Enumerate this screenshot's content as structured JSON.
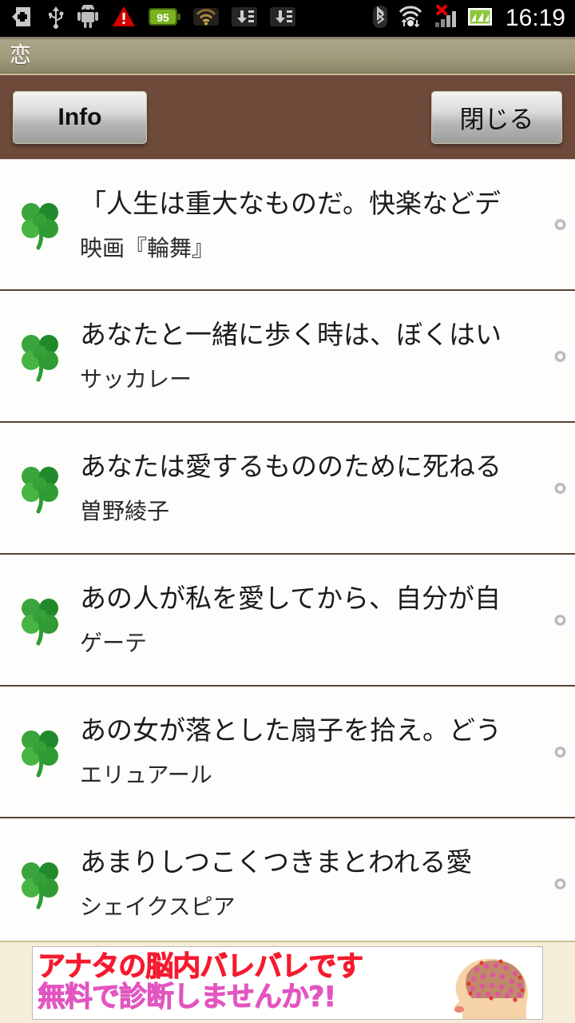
{
  "statusbar": {
    "time": "16:19",
    "battery_level": "95",
    "icons": [
      "shield-plus-icon",
      "usb-icon",
      "android-robot-icon",
      "warning-triangle-icon",
      "battery-95-icon",
      "wifi-brown-icon",
      "download-list-icon-1",
      "download-list-icon-2",
      "bluetooth-icon",
      "wifi-transfer-icon",
      "signal-no-service-icon",
      "signal-graph-icon"
    ]
  },
  "titlebar": {
    "title": "恋"
  },
  "toolbar": {
    "info_label": "Info",
    "close_label": "閉じる"
  },
  "list": {
    "items": [
      {
        "quote": "「人生は重大なものだ。快楽などデ",
        "author": "映画『輪舞』",
        "icon": "clover-icon"
      },
      {
        "quote": "あなたと一緒に歩く時は、ぼくはい",
        "author": "サッカレー",
        "icon": "clover-icon"
      },
      {
        "quote": "あなたは愛するもののために死ねる",
        "author": "曽野綾子",
        "icon": "clover-icon"
      },
      {
        "quote": "あの人が私を愛してから、自分が自",
        "author": "ゲーテ",
        "icon": "clover-icon"
      },
      {
        "quote": "あの女が落とした扇子を拾え。どう",
        "author": "エリュアール",
        "icon": "clover-icon"
      },
      {
        "quote": "あまりしつこくつきまとわれる愛",
        "author": "シェイクスピア",
        "icon": "clover-icon"
      }
    ]
  },
  "ad": {
    "line1": "アナタの脳内バレバレです",
    "line2": "無料で診断しませんか?!",
    "image": "head-brain-icon"
  },
  "colors": {
    "titlebar_khaki": "#a29b7d",
    "buttonbar_brown": "#6d4a3a",
    "divider_brown": "#5d4036",
    "clover_green": "#2e9b33",
    "ad_red": "#f51a2e",
    "ad_pink": "#e255c0",
    "ad_bg": "#f6eed9"
  }
}
